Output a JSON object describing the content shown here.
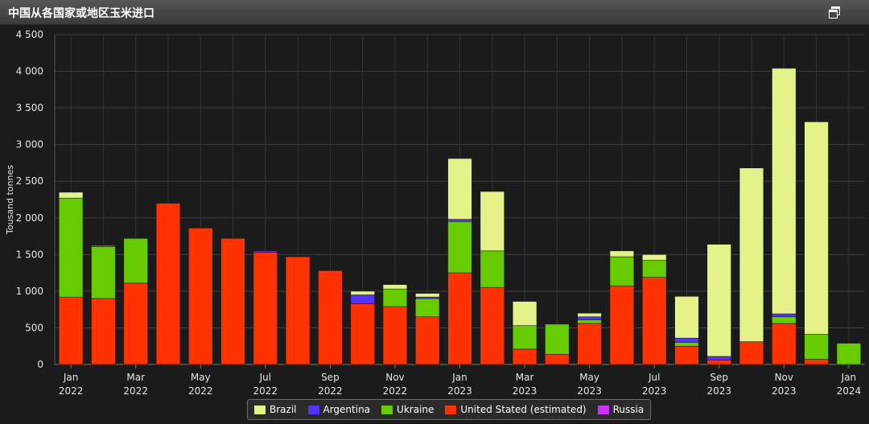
{
  "window": {
    "title": "中国从各国家或地区玉米进口"
  },
  "chart_data": {
    "type": "bar",
    "stacked": true,
    "title": "中国从各国家或地区玉米进口",
    "ylabel": "Tousand tonnes",
    "ylim": [
      0,
      4500
    ],
    "yticks": [
      0,
      500,
      1000,
      1500,
      2000,
      2500,
      3000,
      3500,
      4000,
      4500
    ],
    "ytick_labels": [
      "0",
      "500",
      "1 000",
      "1 500",
      "2 000",
      "2 500",
      "3 000",
      "3 500",
      "4 000",
      "4 500"
    ],
    "grid": true,
    "legend": "bottom-center",
    "categories": [
      "Jan 2022",
      "Feb 2022",
      "Mar 2022",
      "Apr 2022",
      "May 2022",
      "Jun 2022",
      "Jul 2022",
      "Aug 2022",
      "Sep 2022",
      "Oct 2022",
      "Nov 2022",
      "Dec 2022",
      "Jan 2023",
      "Feb 2023",
      "Mar 2023",
      "Apr 2023",
      "May 2023",
      "Jun 2023",
      "Jul 2023",
      "Aug 2023",
      "Sep 2023",
      "Oct 2023",
      "Nov 2023",
      "Dec 2023",
      "Jan 2024"
    ],
    "xtick_labels": [
      {
        "index": 0,
        "month": "Jan",
        "year": "2022"
      },
      {
        "index": 2,
        "month": "Mar",
        "year": "2022"
      },
      {
        "index": 4,
        "month": "May",
        "year": "2022"
      },
      {
        "index": 6,
        "month": "Jul",
        "year": "2022"
      },
      {
        "index": 8,
        "month": "Sep",
        "year": "2022"
      },
      {
        "index": 10,
        "month": "Nov",
        "year": "2022"
      },
      {
        "index": 12,
        "month": "Jan",
        "year": "2023"
      },
      {
        "index": 14,
        "month": "Mar",
        "year": "2023"
      },
      {
        "index": 16,
        "month": "May",
        "year": "2023"
      },
      {
        "index": 18,
        "month": "Jul",
        "year": "2023"
      },
      {
        "index": 20,
        "month": "Sep",
        "year": "2023"
      },
      {
        "index": 22,
        "month": "Nov",
        "year": "2023"
      },
      {
        "index": 24,
        "month": "Jan",
        "year": "2024"
      }
    ],
    "series": [
      {
        "name": "United Stated (estimated)",
        "color": "#ff3300",
        "values": [
          920,
          900,
          1110,
          2200,
          1860,
          1720,
          1530,
          1470,
          1280,
          830,
          790,
          650,
          1250,
          1050,
          210,
          140,
          560,
          1070,
          1190,
          250,
          60,
          310,
          560,
          70,
          0
        ]
      },
      {
        "name": "Ukraine",
        "color": "#66cc00",
        "values": [
          1350,
          710,
          610,
          0,
          0,
          0,
          0,
          0,
          0,
          0,
          240,
          250,
          700,
          500,
          320,
          410,
          50,
          400,
          230,
          50,
          0,
          0,
          90,
          340,
          290
        ]
      },
      {
        "name": "Argentina",
        "color": "#5533ff",
        "values": [
          0,
          0,
          0,
          0,
          0,
          0,
          20,
          0,
          0,
          120,
          0,
          20,
          30,
          0,
          0,
          0,
          40,
          0,
          0,
          60,
          50,
          0,
          40,
          0,
          0
        ]
      },
      {
        "name": "Russia",
        "color": "#cc33ff",
        "values": [
          0,
          0,
          0,
          0,
          0,
          0,
          0,
          0,
          0,
          0,
          0,
          0,
          0,
          0,
          0,
          0,
          0,
          0,
          0,
          0,
          0,
          0,
          0,
          0,
          0
        ]
      },
      {
        "name": "Brazil",
        "color": "#e4f28a",
        "values": [
          80,
          10,
          0,
          0,
          0,
          0,
          0,
          0,
          0,
          50,
          60,
          50,
          830,
          810,
          330,
          0,
          50,
          80,
          80,
          570,
          1530,
          2370,
          3350,
          2900,
          0
        ]
      }
    ],
    "legend_order": [
      "Brazil",
      "Argentina",
      "Ukraine",
      "United Stated (estimated)",
      "Russia"
    ]
  }
}
